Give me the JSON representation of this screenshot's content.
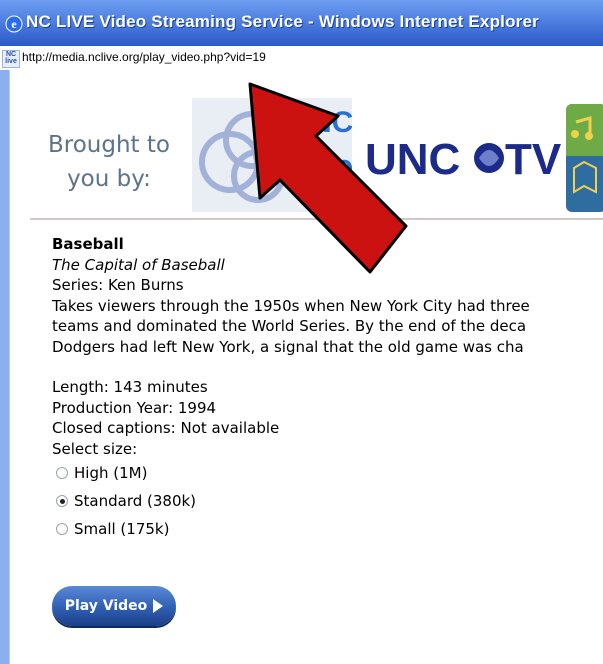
{
  "window": {
    "title": "NC LIVE Video Streaming Service - Windows Internet Explorer",
    "url": "http://media.nclive.org/play_video.php?vid=19",
    "favicon_text": "NC\nlive"
  },
  "header": {
    "brought_by_line1": "Brought to",
    "brought_by_line2": "you by:",
    "nclive_logo_text": "NC\nlive",
    "unc_logo_text": "UNC TV"
  },
  "video": {
    "title": "Baseball",
    "subtitle": "The Capital of Baseball",
    "series": "Series: Ken Burns",
    "description_lines": [
      "Takes viewers through the 1950s when New York City had three",
      "teams and dominated the World Series. By the end of the deca",
      "Dodgers had left New York, a signal that the old game was cha"
    ],
    "length": "Length: 143 minutes",
    "production_year": "Production Year: 1994",
    "captions": "Closed captions: Not available",
    "select_size_label": "Select size:",
    "size_options": [
      {
        "label": "High (1M)",
        "checked": false
      },
      {
        "label": "Standard (380k)",
        "checked": true
      },
      {
        "label": "Small (175k)",
        "checked": false
      }
    ],
    "play_button_label": "Play Video"
  },
  "colors": {
    "titlebar_top": "#6d9ef2",
    "titlebar_bottom": "#2b5ac8",
    "brought_text": "#5c7389",
    "arrow": "#cc1111",
    "play_button": "#2f5fb4"
  }
}
